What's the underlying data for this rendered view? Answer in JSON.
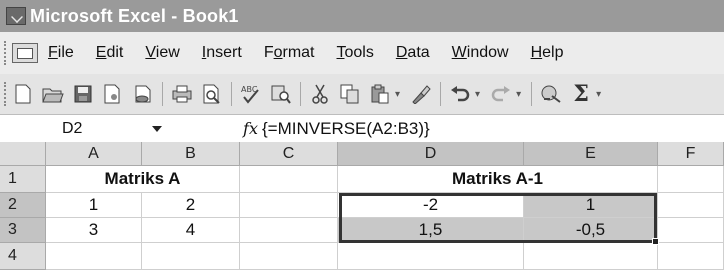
{
  "window": {
    "title": "Microsoft Excel - Book1",
    "app_icon": "excel-icon"
  },
  "menu": {
    "items": [
      {
        "label": "File",
        "u": "F"
      },
      {
        "label": "Edit",
        "u": "E"
      },
      {
        "label": "View",
        "u": "V"
      },
      {
        "label": "Insert",
        "u": "I"
      },
      {
        "label": "Format",
        "u": "o"
      },
      {
        "label": "Tools",
        "u": "T"
      },
      {
        "label": "Data",
        "u": "D"
      },
      {
        "label": "Window",
        "u": "W"
      },
      {
        "label": "Help",
        "u": "H"
      }
    ]
  },
  "toolbar": {
    "icons": [
      "new-icon",
      "open-icon",
      "save-icon",
      "permission-icon",
      "email-icon",
      "print-icon",
      "print-preview-icon",
      "spelling-icon",
      "research-icon",
      "cut-icon",
      "copy-icon",
      "paste-icon",
      "format-painter-icon",
      "undo-icon",
      "redo-icon",
      "hyperlink-icon",
      "autosum-icon"
    ],
    "sum_glyph": "Σ"
  },
  "formula_bar": {
    "name_box": "D2",
    "fx_label": "fx",
    "formula": "{=MINVERSE(A2:B3)}"
  },
  "sheet": {
    "columns": [
      "A",
      "B",
      "C",
      "D",
      "E",
      "F"
    ],
    "rows": [
      "1",
      "2",
      "3",
      "4"
    ],
    "cells": {
      "A1_B1": "Matriks A",
      "D1_E1": "Matriks A-1",
      "A2": "1",
      "B2": "2",
      "A3": "3",
      "B3": "4",
      "D2": "-2",
      "E2": "1",
      "D3": "1,5",
      "E3": "-0,5"
    },
    "selection": "D2:E3",
    "colors": {
      "selection_fill": "#c8c8c8",
      "header_fill": "#dddddd",
      "title_bar": "#9a9a9a"
    }
  }
}
